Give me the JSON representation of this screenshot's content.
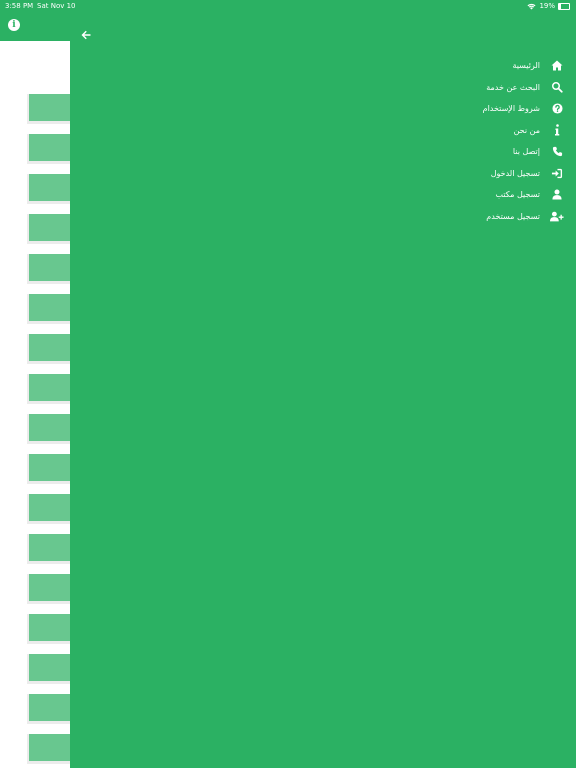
{
  "status_bar": {
    "time": "3:58 PM",
    "date": "Sat Nov 10",
    "battery": "19%",
    "battery_level": 0.19
  },
  "colors": {
    "brand_green": "#2bb163",
    "tile_green": "#68c78f",
    "text_on_brand": "#ffffff"
  },
  "drawer": {
    "menu": [
      {
        "label": "الرئيسية",
        "icon": "home-icon"
      },
      {
        "label": "البحث عن خدمة",
        "icon": "search-icon"
      },
      {
        "label": "شروط الإستخدام",
        "icon": "question-circle-icon"
      },
      {
        "label": "من نحن",
        "icon": "info-icon"
      },
      {
        "label": "إتصل بنا",
        "icon": "phone-icon"
      },
      {
        "label": "تسجيل الدخول",
        "icon": "sign-in-icon"
      },
      {
        "label": "تسجيل مكتب",
        "icon": "user-icon"
      },
      {
        "label": "تسجيل مستخدم",
        "icon": "user-plus-icon"
      }
    ]
  }
}
